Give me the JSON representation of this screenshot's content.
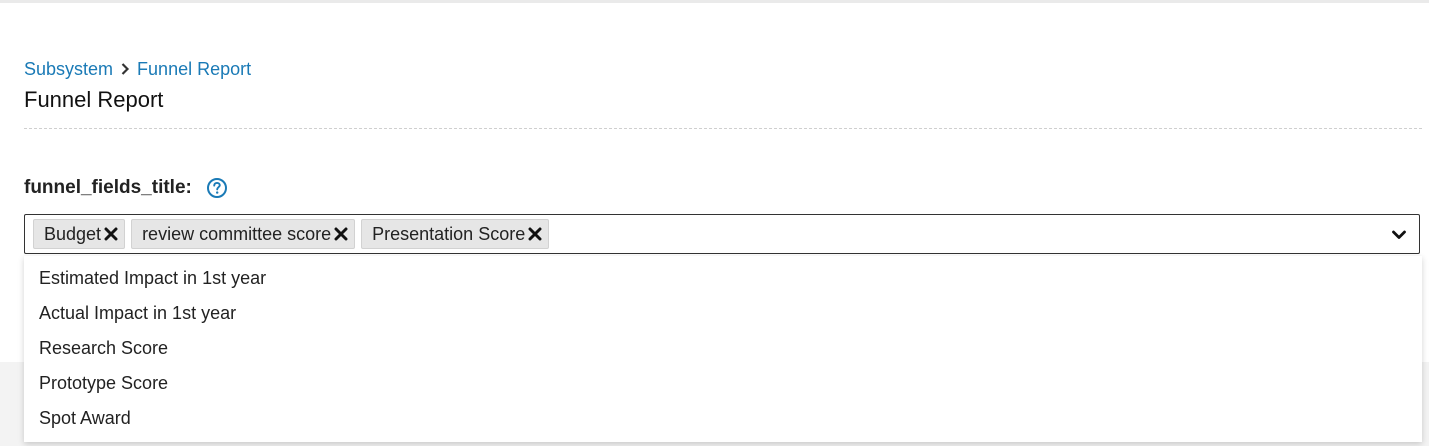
{
  "breadcrumb": {
    "items": [
      "Subsystem",
      "Funnel Report"
    ]
  },
  "page": {
    "title": "Funnel Report"
  },
  "field": {
    "label": "funnel_fields_title:",
    "help_icon": "question-circle-icon",
    "selected_chips": [
      "Budget",
      "review committee score",
      "Presentation Score"
    ],
    "remove_icon": "close-icon",
    "dropdown_icon": "chevron-down-icon",
    "options": [
      "Estimated Impact in 1st year",
      "Actual Impact in 1st year",
      "Research Score",
      "Prototype Score",
      "Spot Award"
    ]
  },
  "colors": {
    "link": "#1a7ab6",
    "chip_bg": "#e6e6e6"
  }
}
